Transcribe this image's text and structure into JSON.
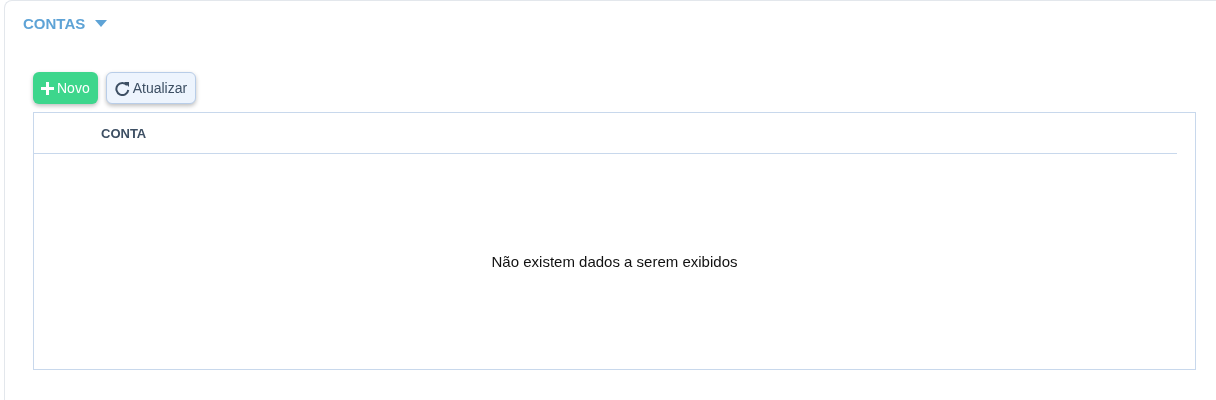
{
  "section": {
    "title": "CONTAS",
    "expanded": true
  },
  "buttons": [
    {
      "kind": "new",
      "label": "Novo"
    },
    {
      "kind": "refresh",
      "label": "Atualizar"
    }
  ],
  "table": {
    "columns": [
      "CONTA"
    ],
    "empty_message": "Não existem dados a serem exibidos"
  }
}
